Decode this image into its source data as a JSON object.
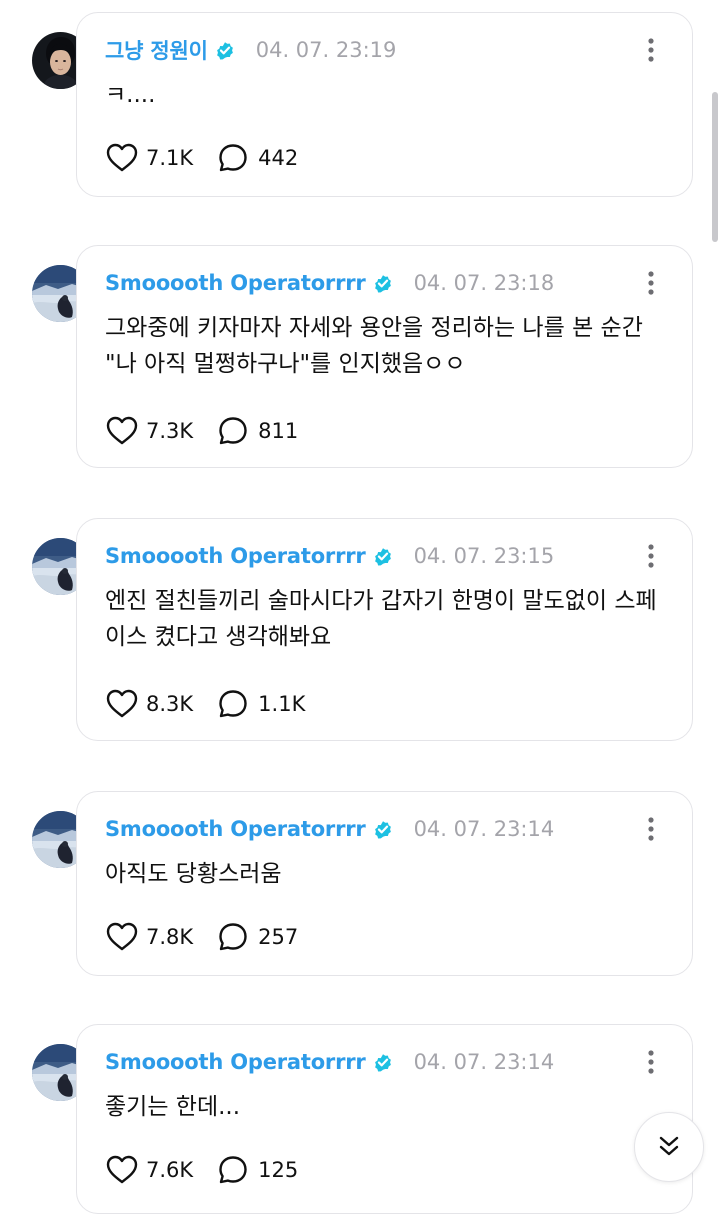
{
  "posts": [
    {
      "name": "그냥 정원이",
      "time": "04. 07. 23:19",
      "text": "ㅋ....",
      "likes": "7.1K",
      "replies": "442",
      "avatar": "portrait-avatar"
    },
    {
      "name": "Smooooth Operatorrrr",
      "time": "04. 07. 23:18",
      "text": "그와중에 키자마자 자세와 용안을 정리하는 나를 본 순간 \"나 아직 멀쩡하구나\"를 인지했음ㅇㅇ",
      "likes": "7.3K",
      "replies": "811",
      "avatar": "snow-landscape-avatar"
    },
    {
      "name": "Smooooth Operatorrrr",
      "time": "04. 07. 23:15",
      "text": "엔진 절친들끼리 술마시다가 갑자기 한명이 말도없이 스페이스 켰다고 생각해봐요",
      "likes": "8.3K",
      "replies": "1.1K",
      "avatar": "snow-landscape-avatar"
    },
    {
      "name": "Smooooth Operatorrrr",
      "time": "04. 07. 23:14",
      "text": "아직도 당황스러움",
      "likes": "7.8K",
      "replies": "257",
      "avatar": "snow-landscape-avatar"
    },
    {
      "name": "Smooooth Operatorrrr",
      "time": "04. 07. 23:14",
      "text": "좋기는 한데...",
      "likes": "7.6K",
      "replies": "125",
      "avatar": "snow-landscape-avatar"
    }
  ],
  "icons": {
    "verified": "verified-badge-icon",
    "like": "heart-icon",
    "reply": "speech-bubble-icon",
    "more": "more-vertical-icon",
    "scroll": "double-chevron-down-icon"
  },
  "colors": {
    "name": "#2d9be8",
    "verified": "#1dc0e2",
    "timestamp": "#a4a4aa",
    "card_border": "#e4e4e8"
  }
}
